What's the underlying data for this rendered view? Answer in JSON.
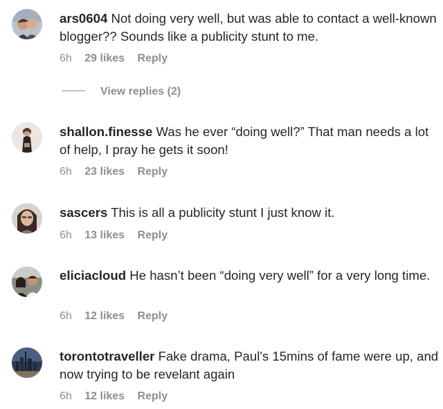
{
  "comments": [
    {
      "username": "ars0604",
      "text": "Not doing very well, but was able to contact a well-known blogger?? Sounds like a publicity stunt to me.",
      "time": "6h",
      "likes": "29 likes",
      "reply": "Reply",
      "view_replies": "View replies (2)"
    },
    {
      "username": "shallon.finesse",
      "text": "Was he ever “doing well?” That man needs a lot of help, I pray he gets it soon!",
      "time": "6h",
      "likes": "23 likes",
      "reply": "Reply"
    },
    {
      "username": "sascers",
      "text": "This is all a publicity stunt I just know it.",
      "time": "6h",
      "likes": "13 likes",
      "reply": "Reply"
    },
    {
      "username": "eliciacloud",
      "text": "He hasn’t been “doing very well” for a very long time.",
      "time": "6h",
      "likes": "12 likes",
      "reply": "Reply"
    },
    {
      "username": "torontotraveller",
      "text": "Fake drama, Paul's 15mins of fame were up, and now trying to be revelant again",
      "time": "6h",
      "likes": "12 likes",
      "reply": "Reply"
    }
  ]
}
